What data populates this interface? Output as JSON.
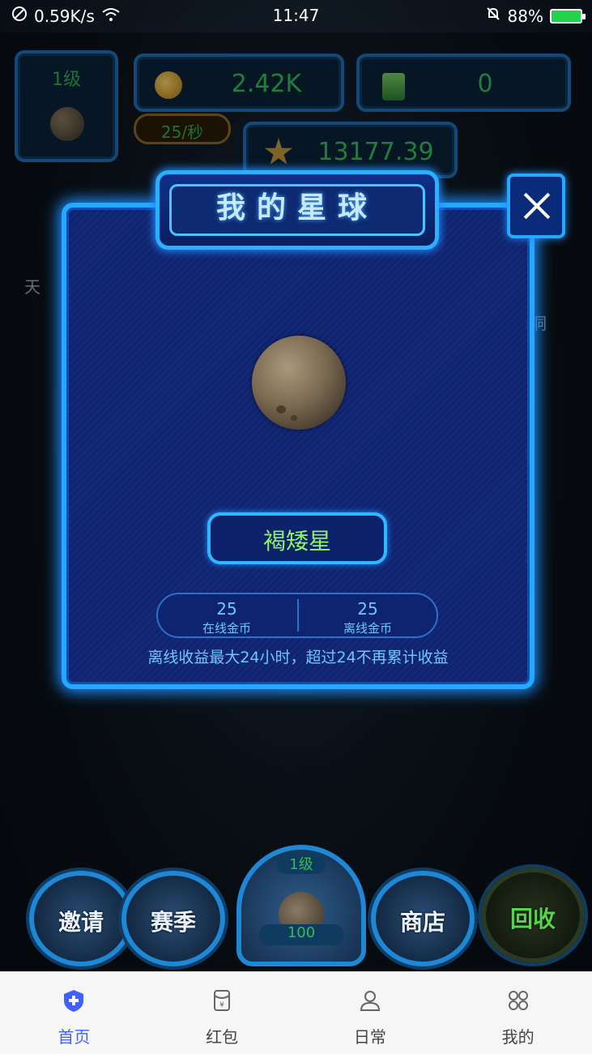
{
  "status_bar": {
    "speed": "0.59K/s",
    "time": "11:47",
    "battery": "88%"
  },
  "hud": {
    "level": "1级",
    "coins": "2.42K",
    "rate": "25/秒",
    "battery_count": "0",
    "stars": "13177.39",
    "left_side_label": "天",
    "right_side_label": "洞"
  },
  "modal": {
    "title": "我的星球",
    "planet_name": "褐矮星",
    "online_coins_value": "25",
    "online_coins_label": "在线金币",
    "offline_coins_value": "25",
    "offline_coins_label": "离线金币",
    "note": "离线收益最大24小时，超过24不再累计收益"
  },
  "game_buttons": {
    "invite": "邀请",
    "season": "赛季",
    "center_level": "1级",
    "center_cost": "100",
    "shop": "商店",
    "recycle": "回收"
  },
  "bottom_nav": {
    "items": [
      {
        "label": "首页",
        "icon": "shield-plus-icon",
        "active": true
      },
      {
        "label": "红包",
        "icon": "red-packet-icon",
        "active": false
      },
      {
        "label": "日常",
        "icon": "user-icon",
        "active": false
      },
      {
        "label": "我的",
        "icon": "grid-icon",
        "active": false
      }
    ]
  },
  "colors": {
    "accent_blue": "#27a8ff",
    "nav_active": "#3d62ff",
    "green_text": "#34c15a",
    "planet_name_green": "#8cf36a"
  }
}
